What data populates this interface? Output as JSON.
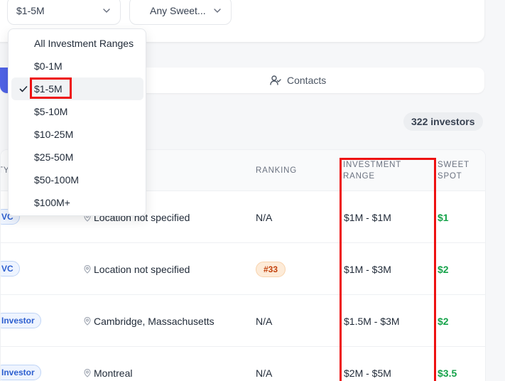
{
  "filters": {
    "investment_range_value": "$1-5M",
    "sweet_spot_value": "Any Sweet..."
  },
  "tabs": {
    "contacts_label": "Contacts"
  },
  "results": {
    "count_label": "322 investors"
  },
  "table": {
    "headers": {
      "type_partial": "TY",
      "ranking": "RANKING",
      "investment_range_line1": "INVESTMENT",
      "investment_range_line2": "RANGE",
      "sweet_spot_line1": "SWEET",
      "sweet_spot_line2": "SPOT"
    },
    "rows": [
      {
        "type": "VC",
        "location": "Location not specified",
        "ranking": "N/A",
        "investment_range": "$1M - $1M",
        "sweet_spot": "$1"
      },
      {
        "type": "VC",
        "location": "Location not specified",
        "ranking": "#33",
        "investment_range": "$1M - $3M",
        "sweet_spot": "$2"
      },
      {
        "type": "Investor",
        "location": "Cambridge, Massachusetts",
        "ranking": "N/A",
        "investment_range": "$1.5M - $3M",
        "sweet_spot": "$2"
      },
      {
        "type": "Investor",
        "location": "Montreal",
        "ranking": "N/A",
        "investment_range": "$2M - $5M",
        "sweet_spot": "$3.5"
      }
    ]
  },
  "dropdown": {
    "options": [
      {
        "label": "All Investment Ranges"
      },
      {
        "label": "$0-1M"
      },
      {
        "label": "$1-5M"
      },
      {
        "label": "$5-10M"
      },
      {
        "label": "$10-25M"
      },
      {
        "label": "$25-50M"
      },
      {
        "label": "$50-100M"
      },
      {
        "label": "$100M+"
      }
    ],
    "selected_label": "$1-5M"
  },
  "colors": {
    "accent": "#4f63e6",
    "highlight": "#ee1111",
    "sweet_spot_text": "#16a34a",
    "type_badge_text": "#2d5fcf",
    "ranking_badge_text": "#c2410c"
  },
  "icons": {
    "chevron": "chevron-down-icon",
    "contacts": "user-check-icon",
    "location": "map-pin-icon",
    "check": "check-icon"
  }
}
